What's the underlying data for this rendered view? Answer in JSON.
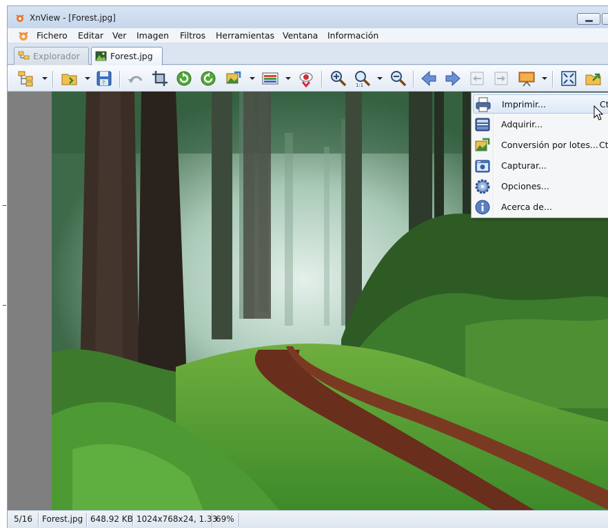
{
  "window": {
    "title": "XnView - [Forest.jpg]"
  },
  "menubar": {
    "items": [
      "Fichero",
      "Editar",
      "Ver",
      "Imagen",
      "Filtros",
      "Herramientas",
      "Ventana",
      "Información"
    ]
  },
  "tabs": [
    {
      "label": "Explorador",
      "active": false,
      "icon": "explorer-tree-icon"
    },
    {
      "label": "Forest.jpg",
      "active": true,
      "icon": "image-thumbnail-icon"
    }
  ],
  "toolbar": {
    "buttons": [
      "browser-tree",
      "open-folder",
      "save",
      "undo",
      "crop",
      "rotate-left",
      "rotate-right",
      "convert",
      "adjust",
      "red-eye",
      "zoom-in",
      "zoom-fit",
      "zoom-out",
      "previous",
      "next",
      "first-page",
      "last-page",
      "slideshow",
      "fullscreen",
      "export"
    ]
  },
  "tools_menu": {
    "items": [
      {
        "label": "Imprimir...",
        "shortcut": "Ct",
        "icon": "printer-icon",
        "highlighted": true
      },
      {
        "label": "Adquirir...",
        "shortcut": "",
        "icon": "scanner-icon",
        "highlighted": false
      },
      {
        "label": "Conversión por lotes...",
        "shortcut": "Ct",
        "icon": "batch-convert-icon",
        "highlighted": false
      },
      {
        "label": "Capturar...",
        "shortcut": "",
        "icon": "camera-icon",
        "highlighted": false
      },
      {
        "label": "Opciones...",
        "shortcut": "",
        "icon": "gear-icon",
        "highlighted": false
      },
      {
        "label": "Acerca de...",
        "shortcut": "",
        "icon": "info-icon",
        "highlighted": false
      }
    ]
  },
  "statusbar": {
    "position": "5/16",
    "filename": "Forest.jpg",
    "filesize": "648.92 KB",
    "dimensions": "1024x768x24, 1.33",
    "zoom": "69%"
  },
  "colors": {
    "accent": "#a8c8ec",
    "window_bg": "#dfe8f3"
  }
}
